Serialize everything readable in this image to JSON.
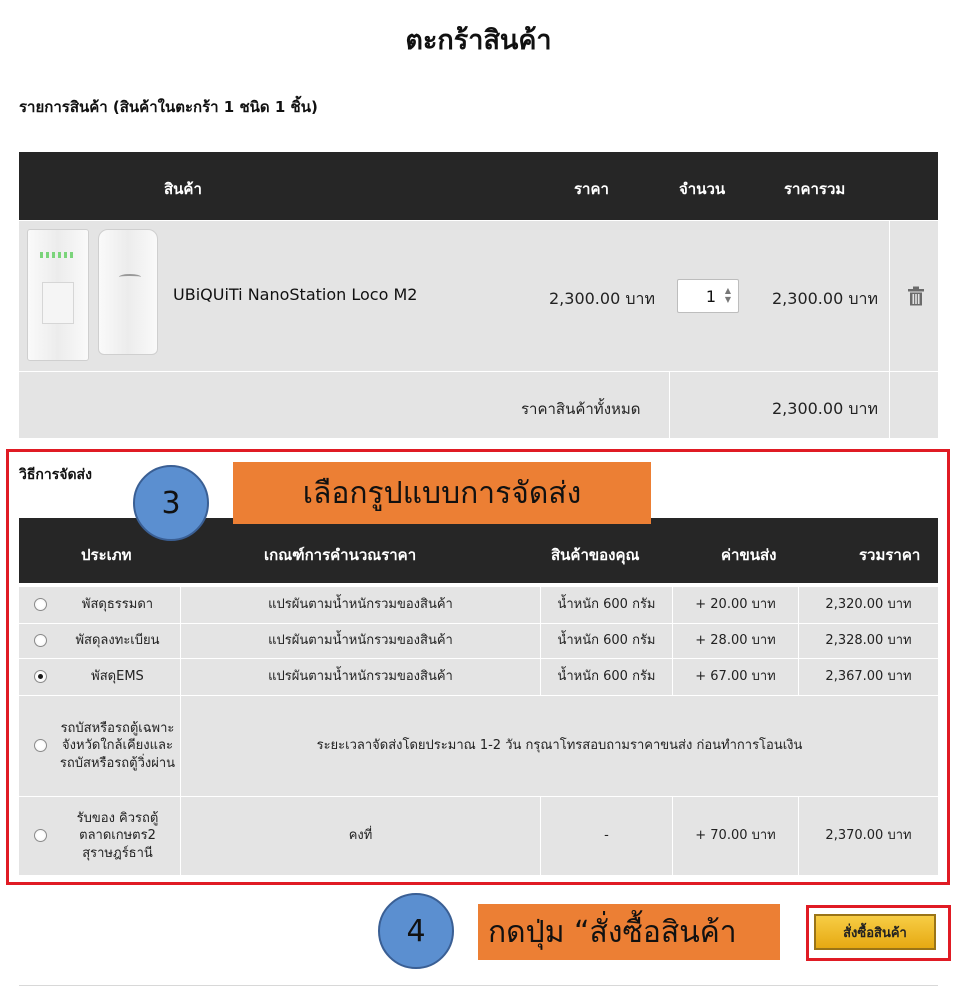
{
  "page_title": "ตะกร้าสินค้า",
  "cart_summary": "รายการสินค้า (สินค้าในตะกร้า 1 ชนิด 1 ชิ้น)",
  "cart_table": {
    "headers": {
      "product": "สินค้า",
      "price": "ราคา",
      "quantity": "จำนวน",
      "total": "ราคารวม"
    },
    "item": {
      "name": "UBiQUiTi NanoStation Loco M2",
      "price": "2,300.00 บาท",
      "quantity": "1",
      "line_total": "2,300.00 บาท"
    },
    "grand_total_label": "ราคาสินค้าทั้งหมด",
    "grand_total_value": "2,300.00 บาท"
  },
  "shipping": {
    "title": "วิธีการจัดส่ง",
    "headers": {
      "type": "ประเภท",
      "criteria": "เกณฑ์การคำนวณราคา",
      "your_item": "สินค้าของคุณ",
      "fee": "ค่าขนส่ง",
      "sum": "รวมราคา"
    },
    "rows": [
      {
        "type": "พัสดุธรรมดา",
        "criteria": "แปรผันตามน้ำหนักรวมของสินค้า",
        "weight": "น้ำหนัก 600 กรัม",
        "fee": "+ 20.00 บาท",
        "sum": "2,320.00 บาท",
        "selected": false
      },
      {
        "type": "พัสดุลงทะเบียน",
        "criteria": "แปรผันตามน้ำหนักรวมของสินค้า",
        "weight": "น้ำหนัก 600 กรัม",
        "fee": "+ 28.00 บาท",
        "sum": "2,328.00 บาท",
        "selected": false
      },
      {
        "type": "พัสดุEMS",
        "criteria": "แปรผันตามน้ำหนักรวมของสินค้า",
        "weight": "น้ำหนัก 600 กรัม",
        "fee": "+ 67.00 บาท",
        "sum": "2,367.00 บาท",
        "selected": true
      },
      {
        "type": "รถบัสหรือรถตู้เฉพาะจังหวัดใกล้เคียงและรถบัสหรือรถตู้วิ่งผ่าน",
        "note": "ระยะเวลาจัดส่งโดยประมาณ 1-2 วัน กรุณาโทรสอบถามราคาขนส่ง ก่อนทำการโอนเงิน",
        "selected": false
      },
      {
        "type": "รับของ คิวรถตู้ ตลาดเกษตร2 สุราษฎร์ธานี",
        "criteria": "คงที่",
        "weight": "-",
        "fee": "+ 70.00 บาท",
        "sum": "2,370.00 บาท",
        "selected": false
      }
    ]
  },
  "callouts": {
    "step3_number": "3",
    "step3_text": "เลือกรูปแบบการจัดส่ง",
    "step4_number": "4",
    "step4_text": "กดปุ่ม “สั่งซื้อสินค้า"
  },
  "order_button_label": "สั่งซื้อสินค้า",
  "colors": {
    "header_bg": "#262626",
    "row_bg": "#e4e4e4",
    "highlight_border": "#e01b24",
    "callout_bg": "#ec7f34",
    "step_circle": "#5b8fd0",
    "button_gold": "#f0be30"
  },
  "icons": {
    "delete": "trash-icon",
    "quantity_spinner": "spinner-icon"
  }
}
